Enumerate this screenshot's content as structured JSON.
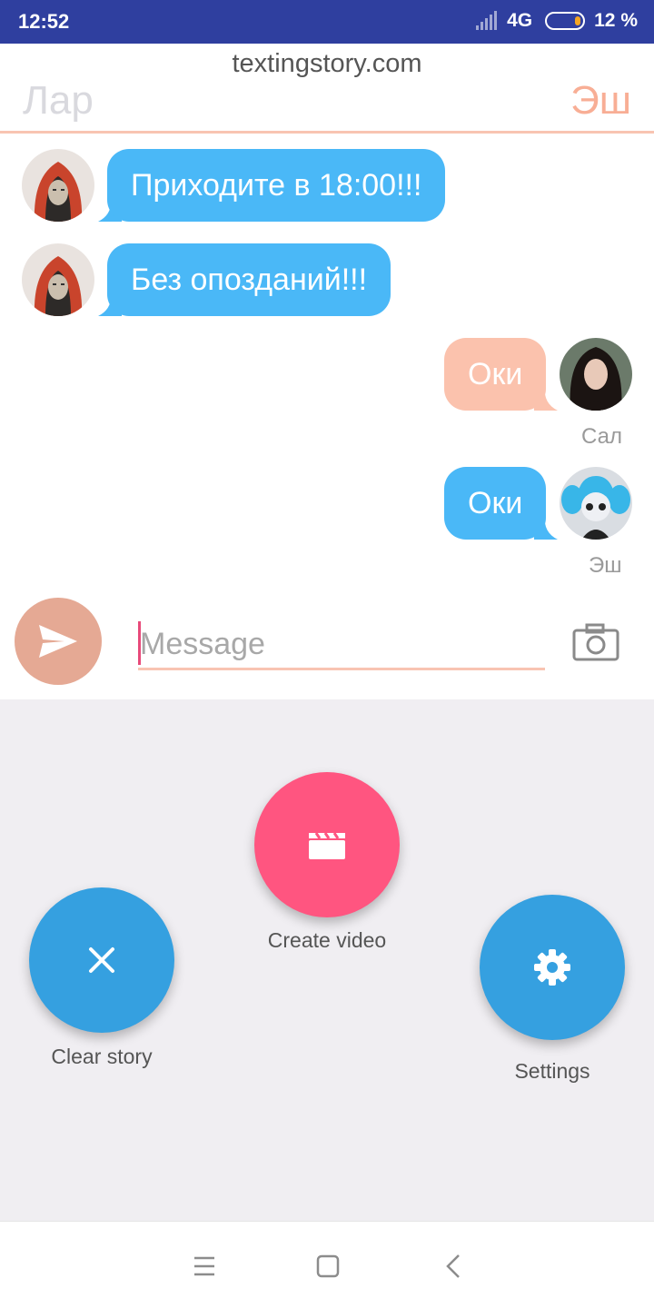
{
  "status_bar": {
    "time": "12:52",
    "network": "4G",
    "battery_percent": "12 %"
  },
  "header": {
    "site": "textingstory.com",
    "left_name": "Лар",
    "right_name": "Эш"
  },
  "messages": [
    {
      "text": "Приходите в 18:00!!!",
      "side": "left",
      "color": "#4ab8f7",
      "avatar": "red-hood-avatar"
    },
    {
      "text": "Без опозданий!!!",
      "side": "left",
      "color": "#4ab8f7",
      "avatar": "red-hood-avatar"
    },
    {
      "text": "Оки",
      "side": "right",
      "color": "#fbc2ad",
      "sender": "Сал",
      "avatar": "dark-hair-woman-avatar"
    },
    {
      "text": "Оки",
      "side": "right",
      "color": "#4ab8f7",
      "sender": "Эш",
      "avatar": "blue-pigtails-avatar"
    }
  ],
  "composer": {
    "placeholder": "Message",
    "send_icon": "send-icon",
    "camera_icon": "camera-icon"
  },
  "actions": {
    "create_video": {
      "label": "Create video",
      "color": "#ff5580",
      "icon": "clapperboard-icon"
    },
    "clear_story": {
      "label": "Clear story",
      "color": "#35a0e0",
      "icon": "close-icon"
    },
    "settings": {
      "label": "Settings",
      "color": "#35a0e0",
      "icon": "gear-icon"
    }
  },
  "nav": {
    "menu_icon": "menu-icon",
    "home_icon": "home-icon",
    "back_icon": "back-icon"
  }
}
